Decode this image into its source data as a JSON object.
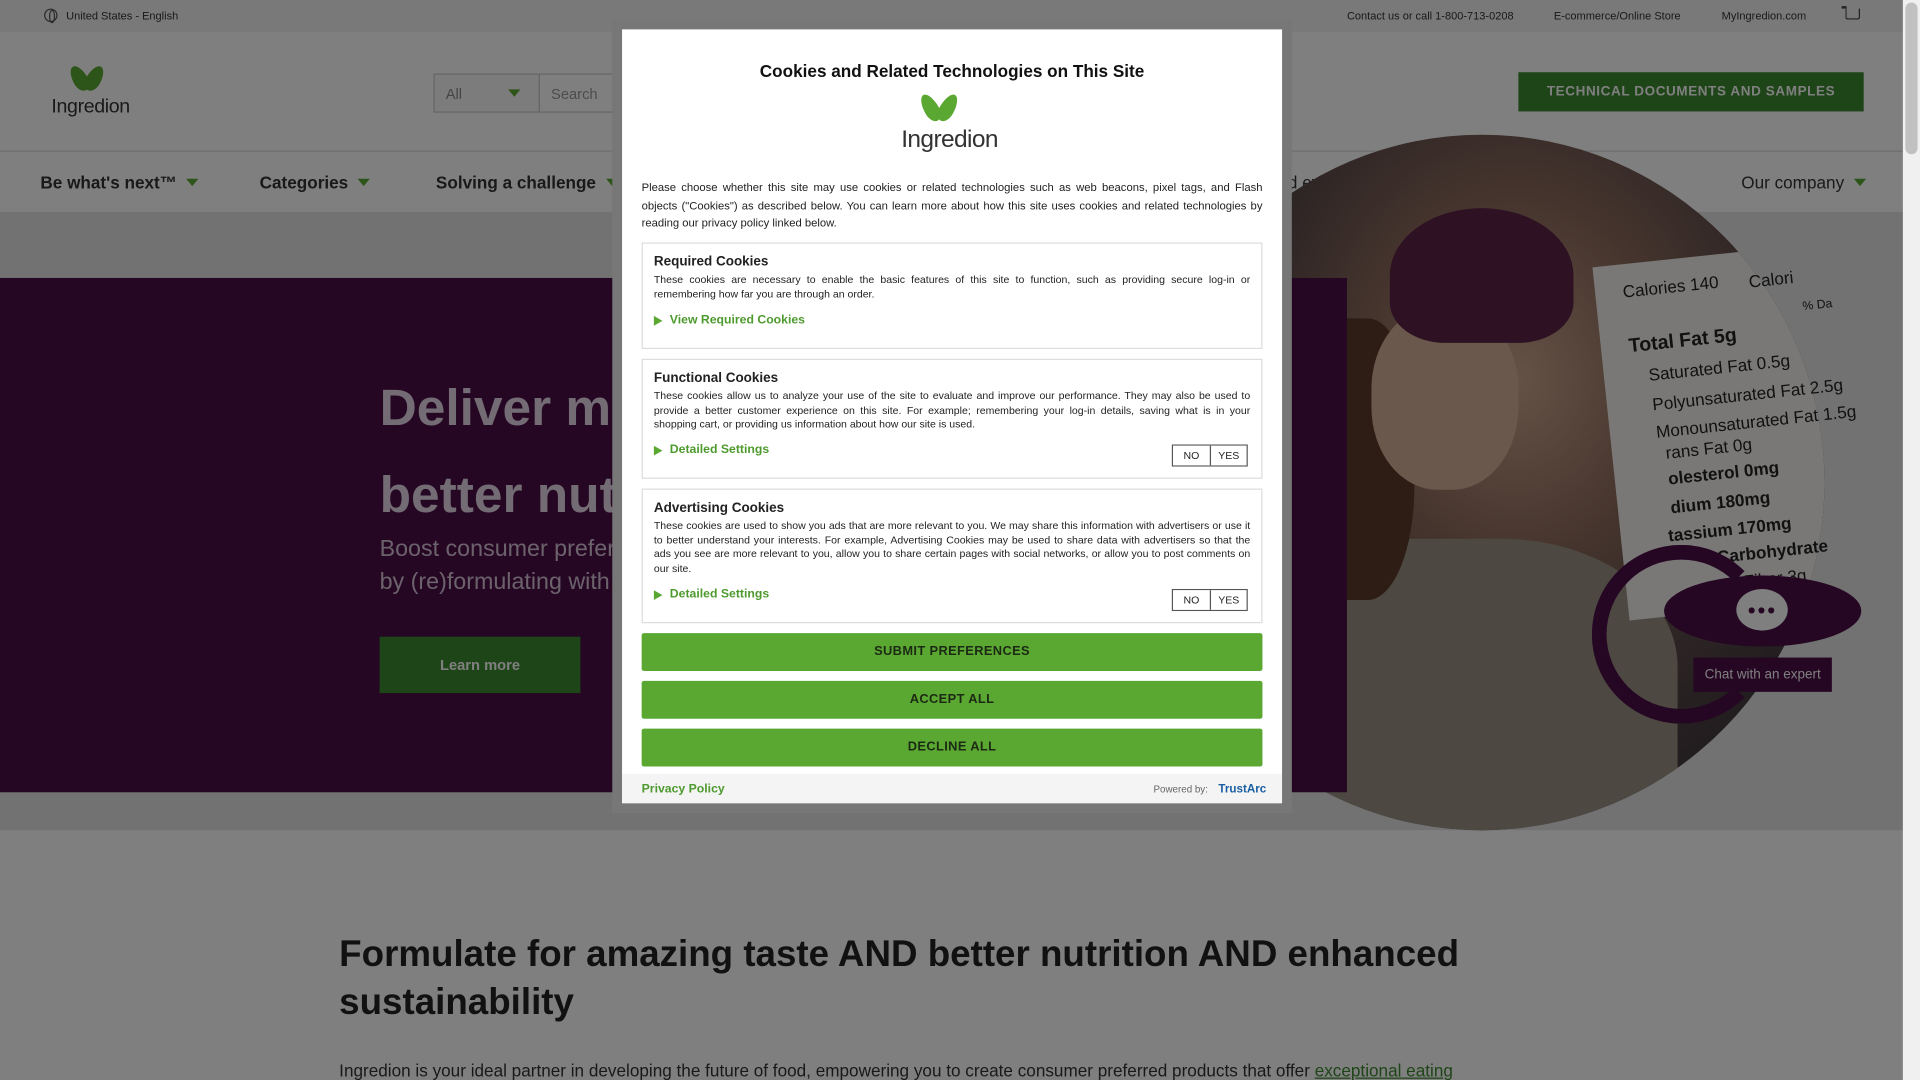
{
  "util_bar": {
    "locale": "United States - English",
    "contact": "Contact us or call 1-800-713-0208",
    "ecommerce": "E-commerce/Online Store",
    "myingredion": "MyIngredion.com"
  },
  "header": {
    "logo_text": "Ingredion",
    "search_category": "All",
    "search_placeholder": "Search",
    "tech_button": "TECHNICAL DOCUMENTS AND SAMPLES"
  },
  "nav": {
    "items": [
      "Be what's next™",
      "Categories",
      "Solving a challenge",
      "nd events",
      "Our company"
    ]
  },
  "hero": {
    "headline_1": "Deliver mo",
    "headline_2": "better nutr",
    "sub_1": "Boost consumer prefer",
    "sub_2": "by (re)formulating with",
    "button": "Learn more"
  },
  "nutrition": [
    "Calories 140",
    "Calori",
    "% Da",
    "Total Fat 5g",
    "Saturated Fat 0.5g",
    "Polyunsaturated Fat 2.5g",
    "Monounsaturated Fat 1.5g",
    "rans Fat 0g",
    "olesterol 0mg",
    "dium 180mg",
    "tassium 170mg",
    "Carbohydrate",
    "Fiber 3g"
  ],
  "chat": {
    "label": "Chat with an expert"
  },
  "section": {
    "heading": "Formulate for amazing taste AND better nutrition AND enhanced sustainability",
    "body": "Ingredion is your ideal partner in developing the future of food, empowering you to create consumer preferred products that offer",
    "link": "exceptional eating"
  },
  "modal": {
    "title": "Cookies and Related Technologies on This Site",
    "logo_text": "Ingredion",
    "intro": "Please choose whether this site may use cookies or related technologies such as web beacons, pixel tags, and Flash objects (\"Cookies\") as described below. You can learn more about how this site uses cookies and related technologies by reading our privacy policy linked below.",
    "required": {
      "title": "Required Cookies",
      "body": "These cookies are necessary to enable the basic features of this site to function, such as providing secure log-in or remembering how far you are through an order.",
      "link": "View Required Cookies"
    },
    "functional": {
      "title": "Functional Cookies",
      "body": "These cookies allow us to analyze your use of the site to evaluate and improve our performance. They may also be used to provide a better customer experience on this site. For example; remembering your log-in details, saving what is in your shopping cart, or providing us information about how our site is used.",
      "link": "Detailed Settings",
      "no": "NO",
      "yes": "YES"
    },
    "advertising": {
      "title": "Advertising Cookies",
      "body": "These cookies are used to show you ads that are more relevant to you. We may share this information with advertisers or use it to better understand your interests. For example, Advertising Cookies may be used to share data with advertisers so that the ads you see are more relevant to you, allow you to share certain pages with social networks, or allow you to post comments on our site.",
      "link": "Detailed Settings",
      "no": "NO",
      "yes": "YES"
    },
    "submit": "SUBMIT PREFERENCES",
    "accept": "ACCEPT ALL",
    "decline": "DECLINE ALL",
    "privacy": "Privacy Policy",
    "powered": "Powered by:",
    "trustarc": "TrustArc"
  },
  "colors": {
    "brand_green": "#5aa832",
    "dark_green": "#3d8b2f",
    "plum": "#4a0f47"
  }
}
